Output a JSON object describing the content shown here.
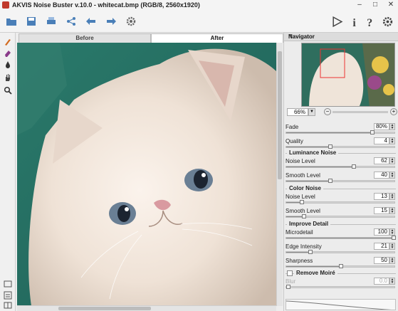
{
  "window": {
    "title": "AKVIS Noise Buster v.10.0 - whitecat.bmp (RGB/8, 2560x1920)",
    "controls": [
      "–",
      "□",
      "✕"
    ]
  },
  "toolbar": {
    "icons": [
      "open-icon",
      "save-icon",
      "print-icon",
      "share-icon",
      "undo-icon",
      "redo-icon",
      "settings-icon"
    ],
    "right_icons": [
      "run-icon",
      "info-icon",
      "help-icon",
      "preferences-icon"
    ]
  },
  "tools": [
    "brush-icon",
    "eraser-icon",
    "drop-icon",
    "hand-icon",
    "zoom-icon"
  ],
  "tabs": {
    "before": "Before",
    "after": "After"
  },
  "panel": {
    "title": "Navigator",
    "zoom": "66%",
    "fade": {
      "label": "Fade",
      "value": "80%",
      "level": 0.8
    },
    "quality": {
      "label": "Quality",
      "value": "4",
      "level": 0.4
    },
    "luminance_group": "Luminance Noise",
    "lum_noise": {
      "label": "Noise Level",
      "value": "62",
      "level": 0.62
    },
    "lum_smooth": {
      "label": "Smooth Level",
      "value": "40",
      "level": 0.4
    },
    "color_group": "Color Noise",
    "col_noise": {
      "label": "Noise Level",
      "value": "13",
      "level": 0.13
    },
    "col_smooth": {
      "label": "Smooth Level",
      "value": "15",
      "level": 0.15
    },
    "improve_group": "Improve Detail",
    "microdetail": {
      "label": "Microdetail",
      "value": "100",
      "level": 1.0
    },
    "edge": {
      "label": "Edge Intensity",
      "value": "21",
      "level": 0.21
    },
    "sharpness": {
      "label": "Sharpness",
      "value": "50",
      "level": 0.5
    },
    "moire_group": "Remove Moiré",
    "blur": {
      "label": "Blur",
      "value": "0.0",
      "level": 0.0
    }
  },
  "colors": {
    "accent": "#3a6ea5",
    "bg": "#ededed"
  }
}
